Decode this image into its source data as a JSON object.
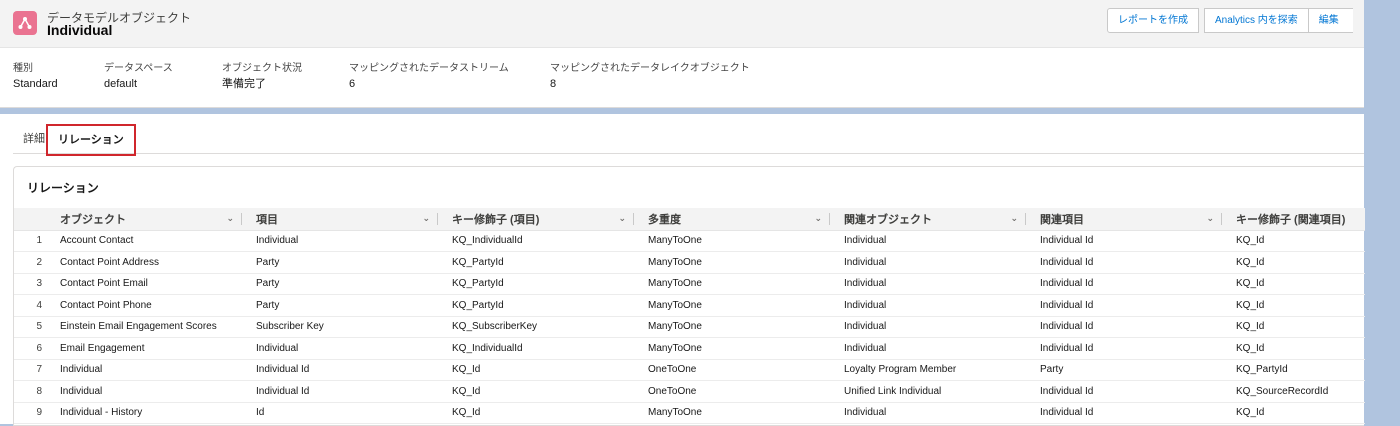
{
  "header": {
    "object_type": "データモデルオブジェクト",
    "object_name": "Individual",
    "icon": "data-model-icon",
    "icon_color": "#ea7391",
    "buttons": [
      "レポートを作成",
      "Analytics 内を探索",
      "編集"
    ]
  },
  "fields": [
    {
      "label": "種別",
      "value": "Standard"
    },
    {
      "label": "データスペース",
      "value": "default"
    },
    {
      "label": "オブジェクト状況",
      "value": "準備完了"
    },
    {
      "label": "マッピングされたデータストリーム",
      "value": "6"
    },
    {
      "label": "マッピングされたデータレイクオブジェクト",
      "value": "8"
    }
  ],
  "tabs": [
    {
      "label": "詳細",
      "active": false
    },
    {
      "label": "リレーション",
      "active": true
    }
  ],
  "relations": {
    "title": "リレーション",
    "columns": [
      "オブジェクト",
      "項目",
      "キー修飾子 (項目)",
      "多重度",
      "関連オブジェクト",
      "関連項目",
      "キー修飾子 (関連項目)"
    ],
    "rows": [
      [
        "1",
        "Account Contact",
        "Individual",
        "KQ_IndividualId",
        "ManyToOne",
        "Individual",
        "Individual Id",
        "KQ_Id"
      ],
      [
        "2",
        "Contact Point Address",
        "Party",
        "KQ_PartyId",
        "ManyToOne",
        "Individual",
        "Individual Id",
        "KQ_Id"
      ],
      [
        "3",
        "Contact Point Email",
        "Party",
        "KQ_PartyId",
        "ManyToOne",
        "Individual",
        "Individual Id",
        "KQ_Id"
      ],
      [
        "4",
        "Contact Point Phone",
        "Party",
        "KQ_PartyId",
        "ManyToOne",
        "Individual",
        "Individual Id",
        "KQ_Id"
      ],
      [
        "5",
        "Einstein Email Engagement Scores",
        "Subscriber Key",
        "KQ_SubscriberKey",
        "ManyToOne",
        "Individual",
        "Individual Id",
        "KQ_Id"
      ],
      [
        "6",
        "Email Engagement",
        "Individual",
        "KQ_IndividualId",
        "ManyToOne",
        "Individual",
        "Individual Id",
        "KQ_Id"
      ],
      [
        "7",
        "Individual",
        "Individual Id",
        "KQ_Id",
        "OneToOne",
        "Loyalty Program Member",
        "Party",
        "KQ_PartyId"
      ],
      [
        "8",
        "Individual",
        "Individual Id",
        "KQ_Id",
        "OneToOne",
        "Unified Link Individual",
        "Individual Id",
        "KQ_SourceRecordId"
      ],
      [
        "9",
        "Individual - History",
        "Id",
        "KQ_Id",
        "ManyToOne",
        "Individual",
        "Individual Id",
        "KQ_Id"
      ]
    ]
  }
}
